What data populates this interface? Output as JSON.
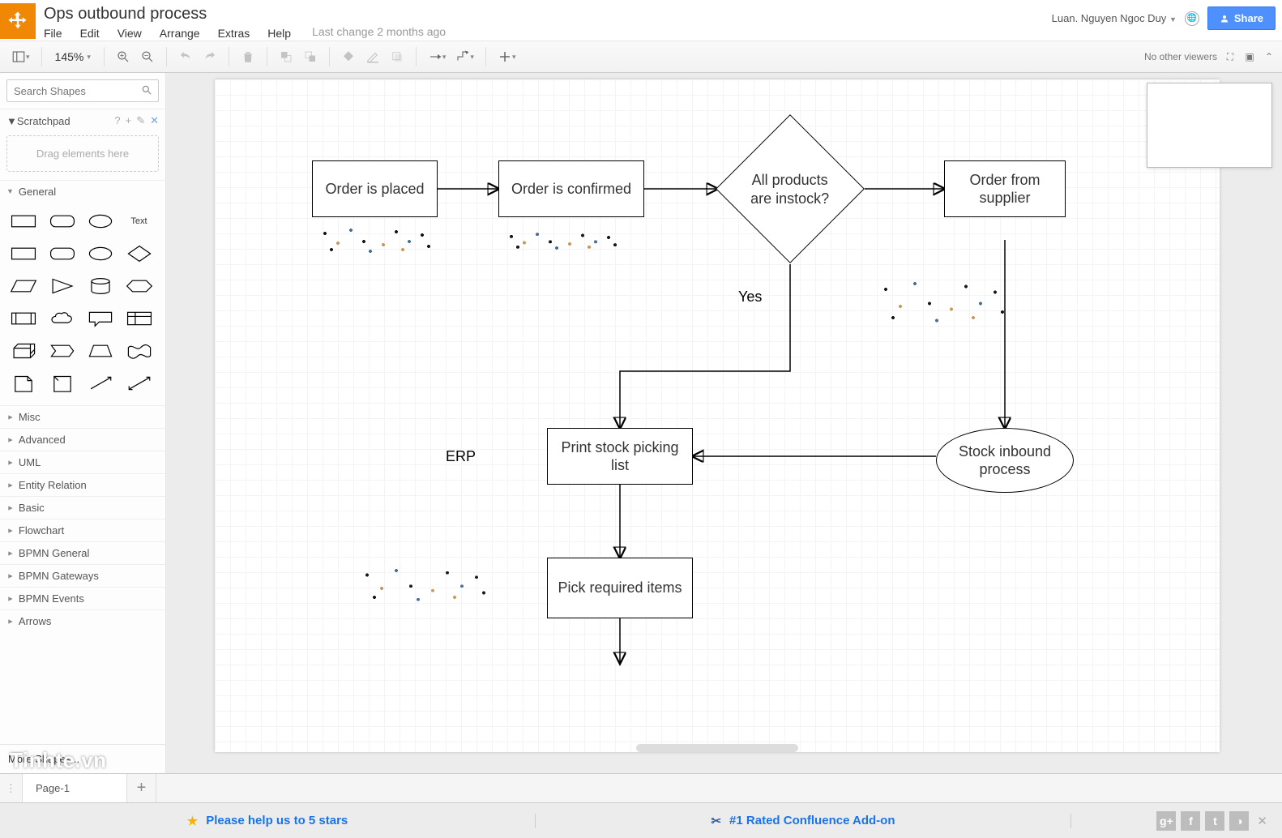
{
  "header": {
    "doc_title": "Ops outbound process",
    "menus": [
      "File",
      "Edit",
      "View",
      "Arrange",
      "Extras",
      "Help"
    ],
    "last_change": "Last change 2 months ago",
    "user_name": "Luan. Nguyen Ngoc Duy",
    "share_label": "Share"
  },
  "toolbar": {
    "zoom": "145%",
    "no_viewers": "No other viewers"
  },
  "sidebar": {
    "search_placeholder": "Search Shapes",
    "scratchpad_label": "Scratchpad",
    "scratchpad_drop": "Drag elements here",
    "general_label": "General",
    "text_shape_label": "Text",
    "categories": [
      "Misc",
      "Advanced",
      "UML",
      "Entity Relation",
      "Basic",
      "Flowchart",
      "BPMN General",
      "BPMN Gateways",
      "BPMN Events",
      "Arrows"
    ],
    "more_shapes": "More Shapes..."
  },
  "diagram": {
    "nodes": {
      "order_placed": "Order is placed",
      "order_confirmed": "Order is confirmed",
      "instock_q": "All products are instock?",
      "order_supplier": "Order from supplier",
      "print_picking": "Print stock picking list",
      "stock_inbound": "Stock inbound process",
      "pick_items": "Pick required items"
    },
    "labels": {
      "yes": "Yes",
      "erp": "ERP"
    }
  },
  "pagetabs": {
    "page1": "Page-1"
  },
  "bottombar": {
    "help_5stars": "Please help us to 5 stars",
    "rated_addon": "#1 Rated Confluence Add-on"
  },
  "watermark": "Tinhte.vn"
}
